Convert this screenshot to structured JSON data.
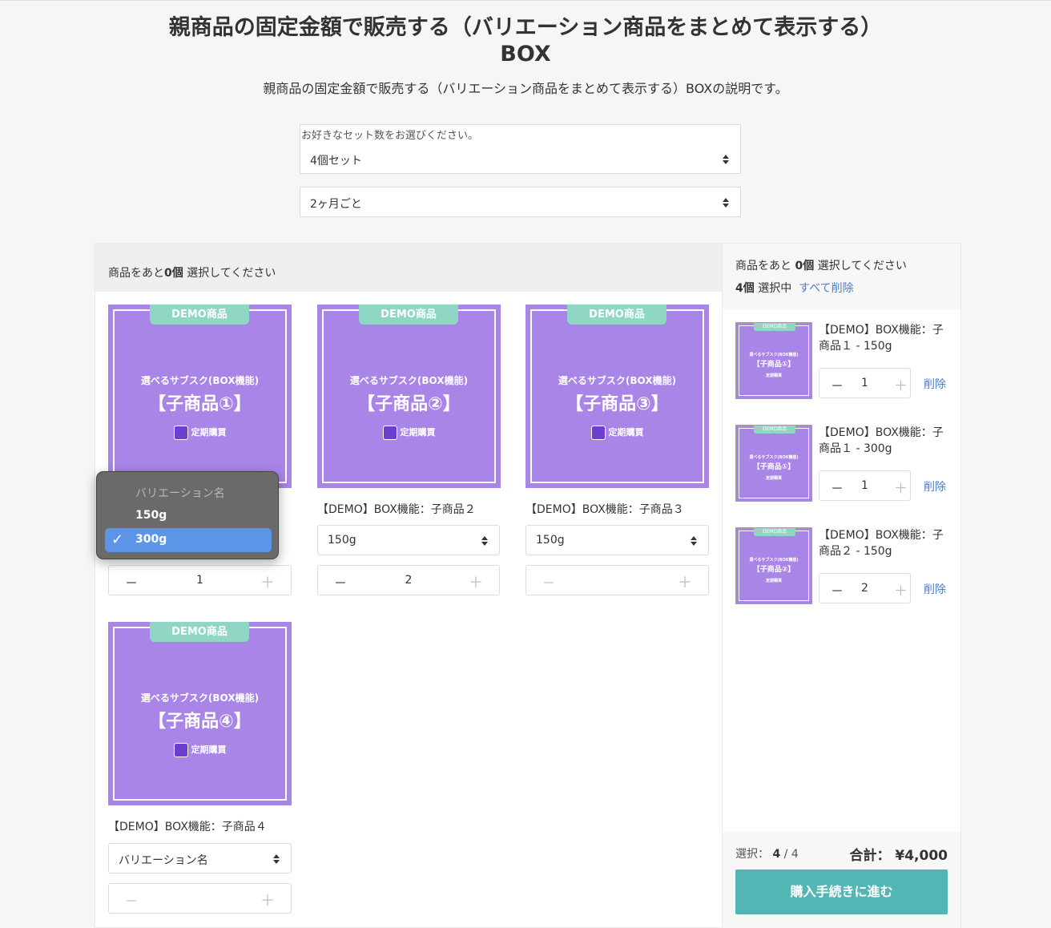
{
  "page": {
    "title_line1": "親商品の固定金額で販売する（バリエーション商品をまとめて表示する）",
    "title_line2": "BOX",
    "description": "親商品の固定金額で販売する（バリエーション商品をまとめて表示する）BOXの説明です。"
  },
  "set_select": {
    "label": "お好きなセット数をお選びください。",
    "value": "4個セット"
  },
  "interval_select": {
    "value": "2ヶ月ごと"
  },
  "main": {
    "header_prefix": "商品をあと",
    "header_count": "0個",
    "header_suffix": " 選択してください"
  },
  "image_text": {
    "demo": "DEMO商品",
    "subtitle": "選べるサブスク(BOX機能)",
    "logo_text": "定期購買"
  },
  "products": [
    {
      "image_title": "【子商品①】",
      "name": "",
      "variation": "",
      "qty": "1"
    },
    {
      "image_title": "【子商品②】",
      "name": "【DEMO】BOX機能：子商品２",
      "variation": "150g",
      "qty": "2"
    },
    {
      "image_title": "【子商品③】",
      "name": "【DEMO】BOX機能：子商品３",
      "variation": "150g",
      "qty": ""
    },
    {
      "image_title": "【子商品④】",
      "name": "【DEMO】BOX機能：子商品４",
      "variation": "バリエーション名",
      "qty": ""
    }
  ],
  "dropdown": {
    "placeholder": "バリエーション名",
    "options": [
      "150g",
      "300g"
    ],
    "selected": "300g"
  },
  "side": {
    "header_prefix": "商品をあと ",
    "header_count": "0個",
    "header_suffix": " 選択してください",
    "selected_count": "4個",
    "selected_label": " 選択中",
    "clear_all": "すべて削除",
    "items": [
      {
        "image_title": "【子商品①】",
        "name": "【DEMO】BOX機能：子商品１ - 150g",
        "qty": "1",
        "delete": "削除"
      },
      {
        "image_title": "【子商品①】",
        "name": "【DEMO】BOX機能：子商品１ - 300g",
        "qty": "1",
        "delete": "削除"
      },
      {
        "image_title": "【子商品②】",
        "name": "【DEMO】BOX機能：子商品２ - 150g",
        "qty": "2",
        "delete": "削除"
      }
    ],
    "footer_select_label": "選択：",
    "footer_select_value": "4",
    "footer_select_total": " / 4",
    "total_label": "合計：",
    "total_value": "¥4,000",
    "checkout_button": "購入手続きに進む"
  },
  "colors": {
    "image_purple": "#a885e6",
    "demo_badge": "#8fd6c4",
    "checkout": "#54b6b4",
    "link": "#4a7fc1",
    "dropdown_highlight": "#5c95e8"
  },
  "icons": {
    "check": "checkmark-icon",
    "minus": "minus-icon",
    "plus": "plus-icon",
    "select_arrows": "select-arrows-icon"
  }
}
